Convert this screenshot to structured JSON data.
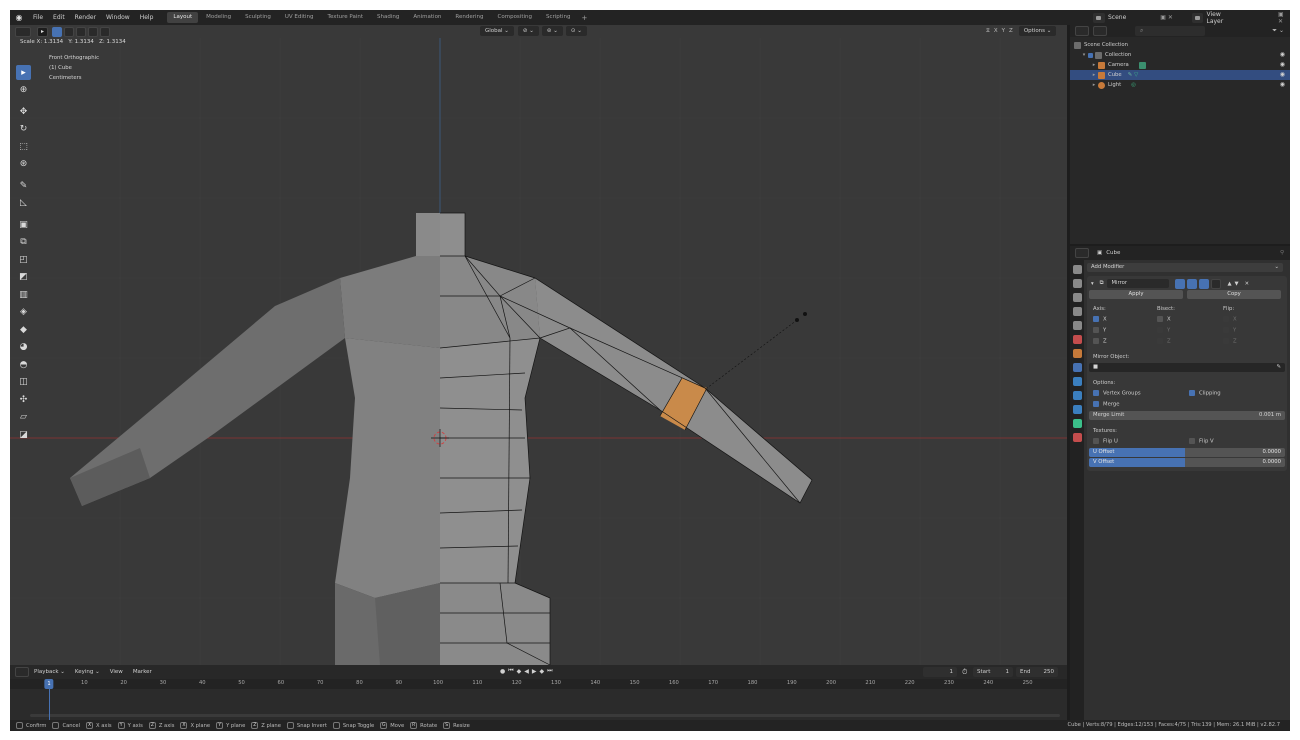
{
  "menu": {
    "items": [
      "File",
      "Edit",
      "Render",
      "Window",
      "Help"
    ],
    "workspaces": [
      "Layout",
      "Modeling",
      "Sculpting",
      "UV Editing",
      "Texture Paint",
      "Shading",
      "Animation",
      "Rendering",
      "Compositing",
      "Scripting"
    ],
    "active_workspace": "Layout",
    "add_label": "+",
    "scene_label": "Scene",
    "view_layer_label": "View Layer"
  },
  "viewport": {
    "scale_readout": "Scale X: 1.3134   Y: 1.3134   Z: 1.3134",
    "info_view": "Front Orthographic",
    "info_object": "(1) Cube",
    "info_units": "Centimeters",
    "orientation": "Global",
    "options_label": "Options",
    "axis_toggles": [
      "X",
      "Y",
      "Z"
    ],
    "tool_icons": [
      "select-box",
      "cursor",
      "move",
      "rotate",
      "scale",
      "transform",
      "annotate",
      "measure",
      "add-cube",
      "extrude",
      "inset",
      "bevel",
      "loop-cut",
      "knife",
      "poly-build",
      "spin",
      "smooth",
      "edge-slide",
      "shrink-fatten",
      "shear",
      "rip"
    ],
    "colors": {
      "background": "#393939",
      "mesh_light": "#8c8c8c",
      "mesh_mid": "#7a7a7a",
      "mesh_dark": "#666666",
      "selection": "#c98a4a",
      "x_axis": "#8b3a3a",
      "accent": "#4772b3"
    }
  },
  "timeline": {
    "menus": [
      "Playback",
      "Keying",
      "View",
      "Marker"
    ],
    "ticks": [
      "10",
      "20",
      "30",
      "40",
      "50",
      "60",
      "70",
      "80",
      "90",
      "100",
      "110",
      "120",
      "130",
      "140",
      "150",
      "160",
      "170",
      "180",
      "190",
      "200",
      "210",
      "220",
      "230",
      "240",
      "250"
    ],
    "current_frame": "1",
    "current_frame_field": "1",
    "start_label": "Start",
    "start_value": "1",
    "end_label": "End",
    "end_value": "250"
  },
  "outliner": {
    "search_placeholder": "",
    "rows": [
      {
        "label": "Scene Collection",
        "icon": "collection-icon"
      },
      {
        "label": "Collection",
        "icon": "collection-icon"
      },
      {
        "label": "Camera",
        "icon": "camera-icon"
      },
      {
        "label": "Cube",
        "icon": "mesh-icon"
      },
      {
        "label": "Light",
        "icon": "light-icon"
      }
    ]
  },
  "properties": {
    "object_name": "Cube",
    "add_modifier": "Add Modifier",
    "modifier_name": "Mirror",
    "apply_label": "Apply",
    "copy_label": "Copy",
    "axis_label": "Axis:",
    "bisect_label": "Bisect:",
    "flip_label": "Flip:",
    "axes": [
      "X",
      "Y",
      "Z"
    ],
    "mirror_object_label": "Mirror Object:",
    "options_label": "Options:",
    "vertex_groups_label": "Vertex Groups",
    "clipping_label": "Clipping",
    "merge_label": "Merge",
    "merge_limit_label": "Merge Limit",
    "merge_limit_value": "0.001 m",
    "textures_label": "Textures:",
    "flip_u_label": "Flip U",
    "flip_v_label": "Flip V",
    "u_offset_label": "U Offset",
    "u_offset_value": "0.0000",
    "v_offset_label": "V Offset",
    "v_offset_value": "0.0000"
  },
  "statusbar": {
    "hints": [
      {
        "key": "",
        "label": "Confirm"
      },
      {
        "key": "",
        "label": "Cancel"
      },
      {
        "key": "X",
        "label": "X axis"
      },
      {
        "key": "Y",
        "label": "Y axis"
      },
      {
        "key": "Z",
        "label": "Z axis"
      },
      {
        "key": "X",
        "label": "X plane"
      },
      {
        "key": "Y",
        "label": "Y plane"
      },
      {
        "key": "Z",
        "label": "Z plane"
      },
      {
        "key": "",
        "label": "Snap Invert"
      },
      {
        "key": "",
        "label": "Snap Toggle"
      },
      {
        "key": "G",
        "label": "Move"
      },
      {
        "key": "R",
        "label": "Rotate"
      },
      {
        "key": "S",
        "label": "Resize"
      }
    ],
    "stats": "Cube | Verts:8/79 | Edges:12/153 | Faces:4/75 | Tris:139 | Mem: 26.1 MiB | v2.82.7"
  }
}
